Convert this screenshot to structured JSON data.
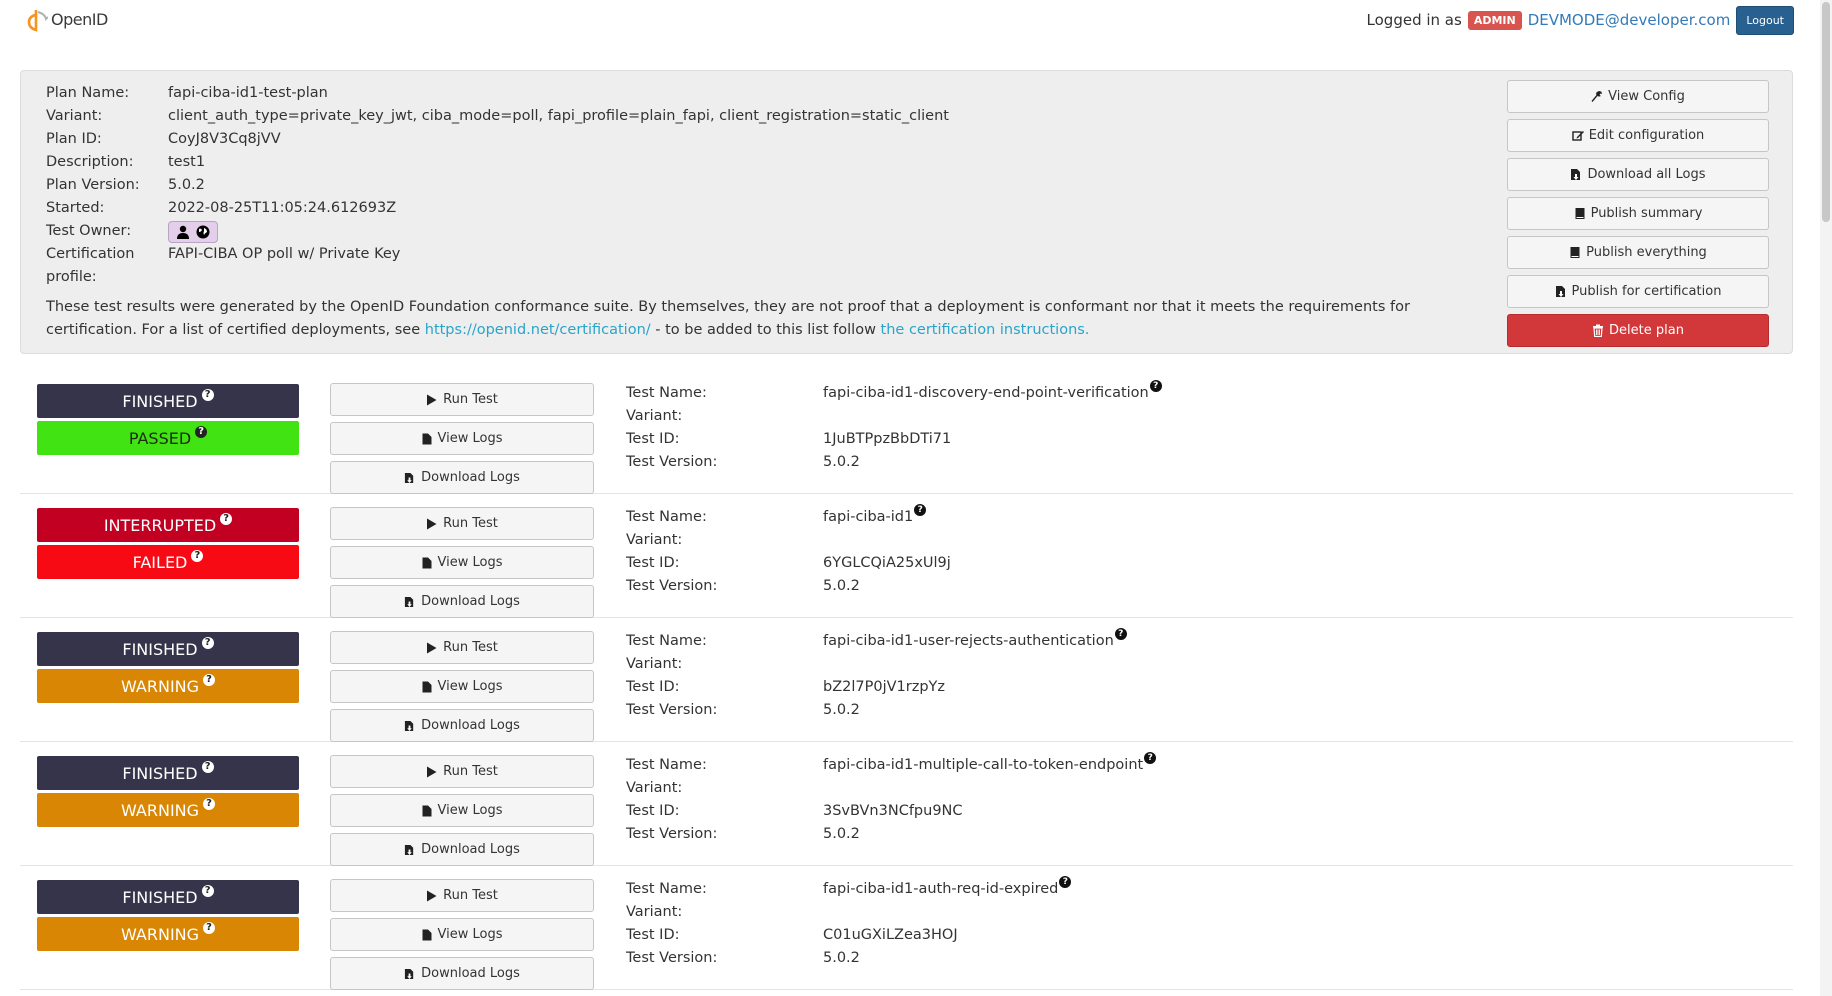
{
  "header": {
    "logo_text": "OpenID",
    "logged_in_label": "Logged in as",
    "role_badge": "ADMIN",
    "user_email": "DEVMODE@developer.com",
    "logout_label": "Logout"
  },
  "plan": {
    "fields": [
      {
        "key": "Plan Name:",
        "value": "fapi-ciba-id1-test-plan"
      },
      {
        "key": "Variant:",
        "value": "client_auth_type=private_key_jwt, ciba_mode=poll, fapi_profile=plain_fapi, client_registration=static_client"
      },
      {
        "key": "Plan ID:",
        "value": "CoyJ8V3Cq8jVV"
      },
      {
        "key": "Description:",
        "value": "test1"
      },
      {
        "key": "Plan Version:",
        "value": "5.0.2"
      },
      {
        "key": "Started:",
        "value": "2022-08-25T11:05:24.612693Z"
      }
    ],
    "owner_key": "Test Owner:",
    "cert_key": "Certification profile:",
    "cert_value": "FAPI-CIBA OP poll w/ Private Key",
    "note_prefix": "These test results were generated by the OpenID Foundation conformance suite. By themselves, they are not proof that a deployment is conformant nor that it meets the requirements for certification. For a list of certified deployments, see",
    "note_link1": "https://openid.net/certification/",
    "note_middle": "- to be added to this list follow",
    "note_link2": "the certification instructions."
  },
  "actions": {
    "view_config": "View Config",
    "edit_config": "Edit configuration",
    "download_all": "Download all Logs",
    "publish_summary": "Publish summary",
    "publish_everything": "Publish everything",
    "publish_cert": "Publish for certification",
    "delete_plan": "Delete plan"
  },
  "labels": {
    "run_test": "Run Test",
    "view_logs": "View Logs",
    "download_logs": "Download Logs",
    "test_name": "Test Name:",
    "variant": "Variant:",
    "test_id": "Test ID:",
    "test_version": "Test Version:"
  },
  "tests": [
    {
      "status": "FINISHED",
      "result": "PASSED",
      "name": "fapi-ciba-id1-discovery-end-point-verification",
      "variant": "",
      "id": "1JuBTPpzBbDTi71",
      "version": "5.0.2"
    },
    {
      "status": "INTERRUPTED",
      "result": "FAILED",
      "name": "fapi-ciba-id1",
      "variant": "",
      "id": "6YGLCQiA25xUl9j",
      "version": "5.0.2"
    },
    {
      "status": "FINISHED",
      "result": "WARNING",
      "name": "fapi-ciba-id1-user-rejects-authentication",
      "variant": "",
      "id": "bZ2l7P0jV1rzpYz",
      "version": "5.0.2"
    },
    {
      "status": "FINISHED",
      "result": "WARNING",
      "name": "fapi-ciba-id1-multiple-call-to-token-endpoint",
      "variant": "",
      "id": "3SvBVn3NCfpu9NC",
      "version": "5.0.2"
    },
    {
      "status": "FINISHED",
      "result": "WARNING",
      "name": "fapi-ciba-id1-auth-req-id-expired",
      "variant": "",
      "id": "C01uGXiLZea3HOJ",
      "version": "5.0.2"
    }
  ],
  "colors": {
    "finished": "#36344a",
    "interrupted": "#c20022",
    "passed": "#42e312",
    "failed": "#f80a14",
    "warning": "#d88603",
    "delete": "#d2383a",
    "link": "#2aa4c9",
    "admin": "#d9534f",
    "logout": "#286090"
  },
  "icons": {
    "view_config": "wrench-icon",
    "edit_config": "edit-icon",
    "download": "file-download-icon",
    "publish": "book-icon",
    "delete": "trash-icon",
    "run": "play-icon",
    "view_logs": "file-icon",
    "help": "question-circle-icon"
  }
}
